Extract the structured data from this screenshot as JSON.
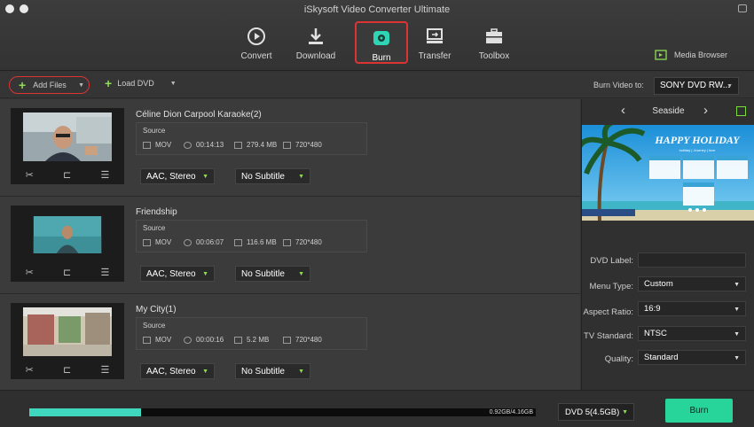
{
  "window": {
    "title": "iSkysoft Video Converter Ultimate"
  },
  "toolbar": {
    "tools": [
      {
        "label": "Convert",
        "icon": "convert-icon"
      },
      {
        "label": "Download",
        "icon": "download-icon"
      },
      {
        "label": "Burn",
        "icon": "burn-icon",
        "active": true
      },
      {
        "label": "Transfer",
        "icon": "transfer-icon"
      },
      {
        "label": "Toolbox",
        "icon": "toolbox-icon"
      }
    ],
    "media_browser": "Media Browser"
  },
  "actions": {
    "add_files": "Add Files",
    "load_dvd": "Load DVD",
    "burn_to_label": "Burn Video to:",
    "burn_to_value": "SONY DVD RW..."
  },
  "items": [
    {
      "title": "Céline Dion Carpool Karaoke(2)",
      "source_label": "Source",
      "format": "MOV",
      "duration": "00:14:13",
      "size": "279.4 MB",
      "resolution": "720*480",
      "audio": "AAC, Stereo",
      "subtitle": "No Subtitle"
    },
    {
      "title": "Friendship",
      "source_label": "Source",
      "format": "MOV",
      "duration": "00:06:07",
      "size": "116.6 MB",
      "resolution": "720*480",
      "audio": "AAC, Stereo",
      "subtitle": "No Subtitle"
    },
    {
      "title": "My City(1)",
      "source_label": "Source",
      "format": "MOV",
      "duration": "00:00:16",
      "size": "5.2 MB",
      "resolution": "720*480",
      "audio": "AAC, Stereo",
      "subtitle": "No Subtitle"
    }
  ],
  "panel": {
    "template_name": "Seaside",
    "preview_title": "HAPPY HOLIDAY",
    "preview_subtitle": "holiday | Journey | love",
    "dvd_label": {
      "label": "DVD Label:",
      "value": ""
    },
    "menu_type": {
      "label": "Menu Type:",
      "value": "Custom"
    },
    "aspect_ratio": {
      "label": "Aspect Ratio:",
      "value": "16:9"
    },
    "tv_standard": {
      "label": "TV Standard:",
      "value": "NTSC"
    },
    "quality": {
      "label": "Quality:",
      "value": "Standard"
    }
  },
  "bottom": {
    "progress_text": "0.92GB/4.16GB",
    "progress_fraction": 0.221,
    "disc": "DVD 5(4.5GB)",
    "burn": "Burn"
  },
  "colors": {
    "accent": "#27d49a",
    "progress": "#3fd7be",
    "highlight": "#dd3333",
    "green_icon": "#8fdc55"
  }
}
